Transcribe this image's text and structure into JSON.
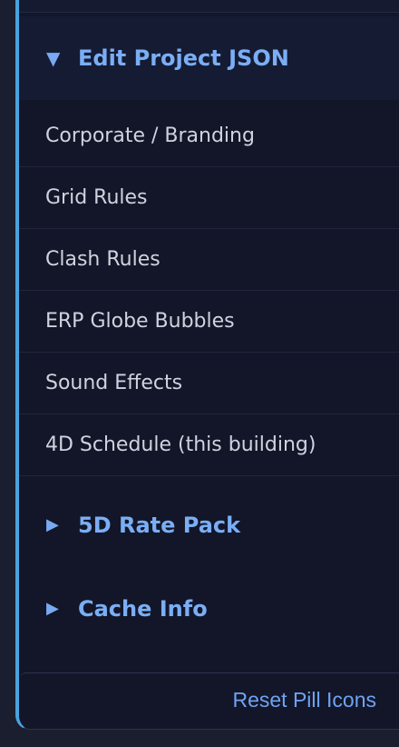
{
  "sections": {
    "edit_project_json": {
      "arrow": "▼",
      "title": "Edit Project JSON"
    },
    "rate_pack": {
      "arrow": "▶",
      "title": "5D Rate Pack"
    },
    "cache_info": {
      "arrow": "▶",
      "title": "Cache Info"
    }
  },
  "items": [
    {
      "label": "Corporate / Branding"
    },
    {
      "label": "Grid Rules"
    },
    {
      "label": "Clash Rules"
    },
    {
      "label": "ERP Globe Bubbles"
    },
    {
      "label": "Sound Effects"
    },
    {
      "label": "4D Schedule (this building)"
    }
  ],
  "footer": {
    "reset_label": "Reset Pill Icons"
  },
  "colors": {
    "accent_border": "#4aa3df",
    "header_text": "#7aaef5",
    "item_text": "#cfd3df",
    "panel_bg": "#121628",
    "page_bg": "#1b1e2e"
  }
}
